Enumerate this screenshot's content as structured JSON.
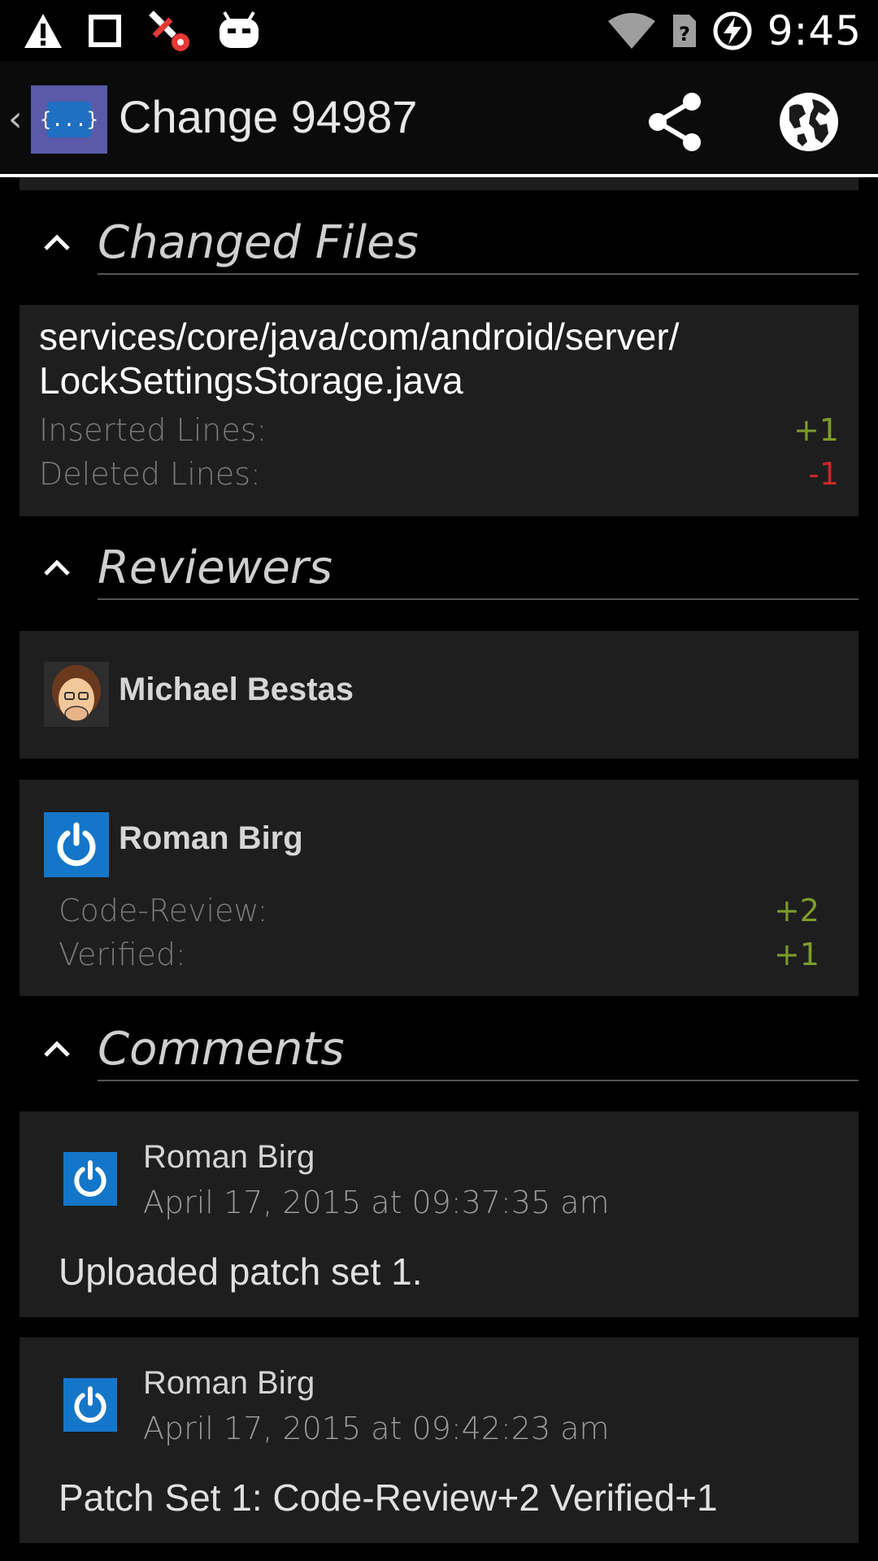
{
  "status_bar": {
    "icons_left": [
      "warning-icon",
      "square-icon",
      "screwdriver-icon",
      "cyanogen-icon"
    ],
    "icons_right": [
      "wifi-icon",
      "sim-unknown-icon",
      "battery-charging-icon"
    ],
    "time": "9:45"
  },
  "app_bar": {
    "up_caret": "‹",
    "logo_text": "{...}",
    "title": "Change 94987",
    "actions": [
      "share-icon",
      "globe-icon"
    ]
  },
  "sections": {
    "changed_files": "Changed Files",
    "reviewers": "Reviewers",
    "comments": "Comments"
  },
  "changed_file": {
    "path_line1": "services/core/java/com/android/server/",
    "path_line2": "LockSettingsStorage.java",
    "inserted_label": "Inserted Lines:",
    "inserted_value": "+1",
    "deleted_label": "Deleted Lines:",
    "deleted_value": "-1"
  },
  "reviewers": [
    {
      "name": "Michael Bestas"
    },
    {
      "name": "Roman Birg",
      "code_review_label": "Code-Review:",
      "code_review_value": "+2",
      "verified_label": "Verified:",
      "verified_value": "+1"
    }
  ],
  "comments": [
    {
      "author": "Roman Birg",
      "date": "April 17, 2015 at 09:37:35 am",
      "body": "Uploaded patch set 1."
    },
    {
      "author": "Roman Birg",
      "date": "April 17, 2015 at 09:42:23 am",
      "body": "Patch Set 1: Code-Review+2 Verified+1"
    }
  ],
  "colors": {
    "positive": "#7d9b2c",
    "negative": "#c62828",
    "card": "#1e1e1e",
    "avatar_blue": "#1476c8"
  }
}
